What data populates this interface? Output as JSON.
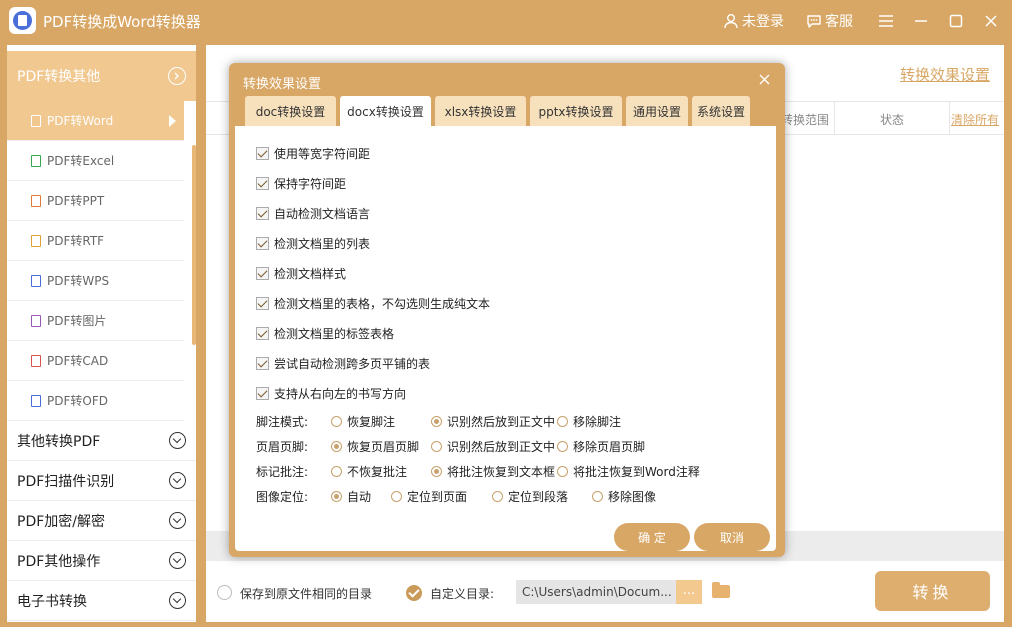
{
  "app": {
    "title": "PDF转换成Word转换器",
    "login_label": "未登录",
    "service_label": "客服"
  },
  "sidebar": {
    "section_title": "PDF转换其他",
    "sub_items": [
      {
        "label": "PDF转Word",
        "icon": "word-file-icon",
        "color": "#4b6fd8"
      },
      {
        "label": "PDF转Excel",
        "icon": "excel-file-icon",
        "color": "#36a852"
      },
      {
        "label": "PDF转PPT",
        "icon": "ppt-file-icon",
        "color": "#e07b39"
      },
      {
        "label": "PDF转RTF",
        "icon": "rtf-file-icon",
        "color": "#e0a039"
      },
      {
        "label": "PDF转WPS",
        "icon": "wps-file-icon",
        "color": "#4b6fd8"
      },
      {
        "label": "PDF转图片",
        "icon": "image-file-icon",
        "color": "#9b59b6"
      },
      {
        "label": "PDF转CAD",
        "icon": "cad-file-icon",
        "color": "#d9534f"
      },
      {
        "label": "PDF转OFD",
        "icon": "ofd-file-icon",
        "color": "#4b6fd8"
      }
    ],
    "groups": [
      {
        "label": "其他转换PDF"
      },
      {
        "label": "PDF扫描件识别"
      },
      {
        "label": "PDF加密/解密"
      },
      {
        "label": "PDF其他操作"
      },
      {
        "label": "电子书转换"
      }
    ]
  },
  "main": {
    "settings_link": "转换效果设置",
    "col_range": "转换范围",
    "col_status": "状态",
    "clear_all": "清除所有",
    "save_same_dir": "保存到原文件相同的目录",
    "custom_dir_label": "自定义目录:",
    "custom_dir_path": "C:\\Users\\admin\\Docum...",
    "browse_label": "...",
    "convert_label": "转换"
  },
  "dialog": {
    "title": "转换效果设置",
    "tabs": [
      {
        "label": "doc转换设置"
      },
      {
        "label": "docx转换设置"
      },
      {
        "label": "xlsx转换设置"
      },
      {
        "label": "pptx转换设置"
      },
      {
        "label": "通用设置"
      },
      {
        "label": "系统设置"
      }
    ],
    "checkboxes": [
      {
        "label": "使用等宽字符间距"
      },
      {
        "label": "保持字符间距"
      },
      {
        "label": "自动检测文档语言"
      },
      {
        "label": "检测文档里的列表"
      },
      {
        "label": "检测文档样式"
      },
      {
        "label": "检测文档里的表格，不勾选则生成纯文本"
      },
      {
        "label": "检测文档里的标签表格"
      },
      {
        "label": "尝试自动检测跨多页平铺的表"
      },
      {
        "label": "支持从右向左的书写方向"
      }
    ],
    "options": [
      {
        "label": "脚注模式:",
        "choices": [
          "恢复脚注",
          "识别然后放到正文中",
          "移除脚注"
        ],
        "selected": 1
      },
      {
        "label": "页眉页脚:",
        "choices": [
          "恢复页眉页脚",
          "识别然后放到正文中",
          "移除页眉页脚"
        ],
        "selected": 0
      },
      {
        "label": "标记批注:",
        "choices": [
          "不恢复批注",
          "将批注恢复到文本框",
          "将批注恢复到Word注释"
        ],
        "selected": 1
      },
      {
        "label": "图像定位:",
        "choices": [
          "自动",
          "定位到页面",
          "定位到段落",
          "移除图像"
        ],
        "selected": 0
      }
    ],
    "ok_label": "确 定",
    "cancel_label": "取消"
  }
}
